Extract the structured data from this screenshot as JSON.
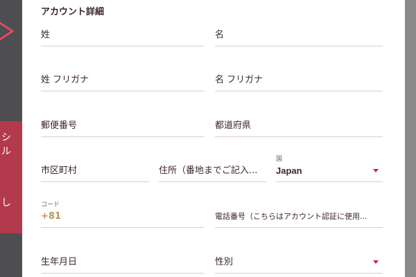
{
  "background": {
    "left_glyphs": [
      "シ",
      "ル",
      "し"
    ]
  },
  "form": {
    "section_title": "アカウント詳細",
    "last_name": "姓",
    "first_name": "名",
    "last_name_kana": "姓 フリガナ",
    "first_name_kana": "名 フリガナ",
    "postal_code": "郵便番号",
    "prefecture": "都道府県",
    "city": "市区町村",
    "address": "住所（番地までご記入...",
    "country_label": "国",
    "country_value": "Japan",
    "code_label": "コード",
    "code_value": "+81",
    "phone": "電話番号（こちらはアカウント認証に使用...",
    "birthdate": "生年月日",
    "gender": "性別"
  },
  "colors": {
    "accent": "#c0283e",
    "gold": "#b8965a",
    "text": "#3a2330",
    "underline": "#d9cfc1"
  }
}
